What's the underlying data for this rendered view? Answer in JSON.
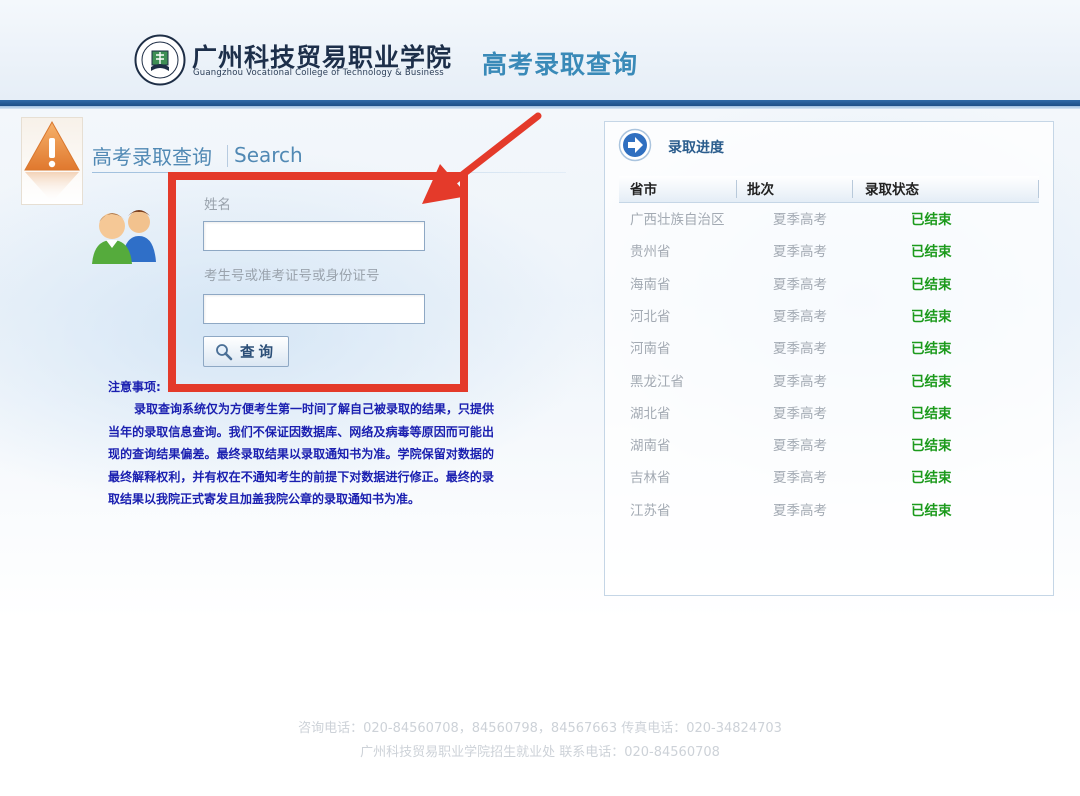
{
  "header": {
    "college_cn": "广州科技贸易职业学院",
    "college_en": "Guangzhou Vocational College of Technology & Business",
    "title": "高考录取查询"
  },
  "search": {
    "title_cn": "高考录取查询",
    "title_en": "Search",
    "name_label": "姓名",
    "name_value": "",
    "id_label": "考生号或准考证号或身份证号",
    "id_value": "",
    "button_label": "查询"
  },
  "notice": {
    "title": "注意事项:",
    "body": "录取查询系统仅为方便考生第一时间了解自己被录取的结果，只提供当年的录取信息查询。我们不保证因数据库、网络及病毒等原因而可能出现的查询结果偏差。最终录取结果以录取通知书为准。学院保留对数据的最终解释权利，并有权在不通知考生的前提下对数据进行修正。最终的录取结果以我院正式寄发且加盖我院公章的录取通知书为准。"
  },
  "progress": {
    "title": "录取进度",
    "columns": [
      "省市",
      "批次",
      "录取状态"
    ],
    "rows": [
      {
        "province": "广西壮族自治区",
        "batch": "夏季高考",
        "status": "已结束"
      },
      {
        "province": "贵州省",
        "batch": "夏季高考",
        "status": "已结束"
      },
      {
        "province": "海南省",
        "batch": "夏季高考",
        "status": "已结束"
      },
      {
        "province": "河北省",
        "batch": "夏季高考",
        "status": "已结束"
      },
      {
        "province": "河南省",
        "batch": "夏季高考",
        "status": "已结束"
      },
      {
        "province": "黑龙江省",
        "batch": "夏季高考",
        "status": "已结束"
      },
      {
        "province": "湖北省",
        "batch": "夏季高考",
        "status": "已结束"
      },
      {
        "province": "湖南省",
        "batch": "夏季高考",
        "status": "已结束"
      },
      {
        "province": "吉林省",
        "batch": "夏季高考",
        "status": "已结束"
      },
      {
        "province": "江苏省",
        "batch": "夏季高考",
        "status": "已结束"
      }
    ]
  },
  "footer": {
    "line1": "咨询电话：020-84560708，84560798，84567663 传真电话：020-34824703",
    "line2": "广州科技贸易职业学院招生就业处   联系电话：020-84560708"
  },
  "colors": {
    "accent_blue": "#3a8ab8",
    "header_bar": "#2f6aa8",
    "highlight_red": "#e43a2a",
    "status_green": "#1c9a1c",
    "notice_blue": "#1a1fb0"
  },
  "icons": [
    "college-logo-icon",
    "warning-icon",
    "users-icon",
    "magnifier-icon",
    "arrow-right-circle-icon",
    "red-arrow-annotation"
  ]
}
